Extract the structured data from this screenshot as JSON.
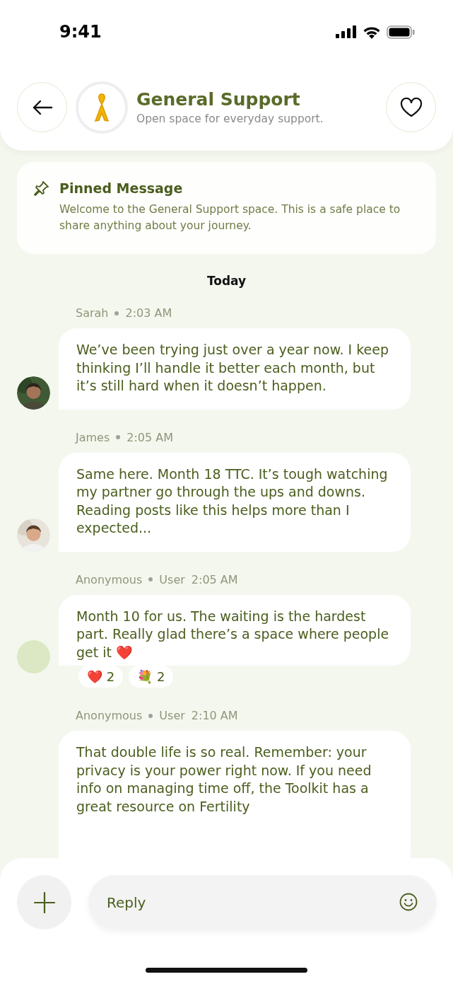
{
  "status_bar": {
    "time": "9:41"
  },
  "header": {
    "title": "General Support",
    "subtitle": "Open space for everyday support."
  },
  "pinned": {
    "title": "Pinned Message",
    "text": "Welcome to the General Support space. This is a safe place to share anything about your journey."
  },
  "date_divider": "Today",
  "messages": [
    {
      "author": "Sarah",
      "time": "2:03 AM",
      "text": "We’ve been trying just over a year now. I keep thinking I’ll handle it better each month, but it’s still hard when it doesn’t happen."
    },
    {
      "author": "James",
      "time": "2:05 AM",
      "text": "Same here. Month 18 TTC. It’s tough watching my partner go through the ups and downs. Reading posts like this helps more than I expected..."
    },
    {
      "kind": "plain",
      "author": "Anonymous",
      "role": "User",
      "time": "2:05 AM",
      "text": "Month 10 for us. The waiting is the hardest part. Really glad there’s a space where people get it ❤️",
      "reactions": [
        {
          "emoji": "❤️",
          "count": "2"
        },
        {
          "emoji": "💐",
          "count": "2"
        }
      ]
    },
    {
      "kind": "cut",
      "author": "Anonymous",
      "role": "User",
      "time": "2:10 AM",
      "text": "That double life is so real. Remember: your privacy is your power right now. If you need info on managing time off, the Toolkit has a great resource on Fertility"
    }
  ],
  "composer": {
    "placeholder": "Reply"
  }
}
